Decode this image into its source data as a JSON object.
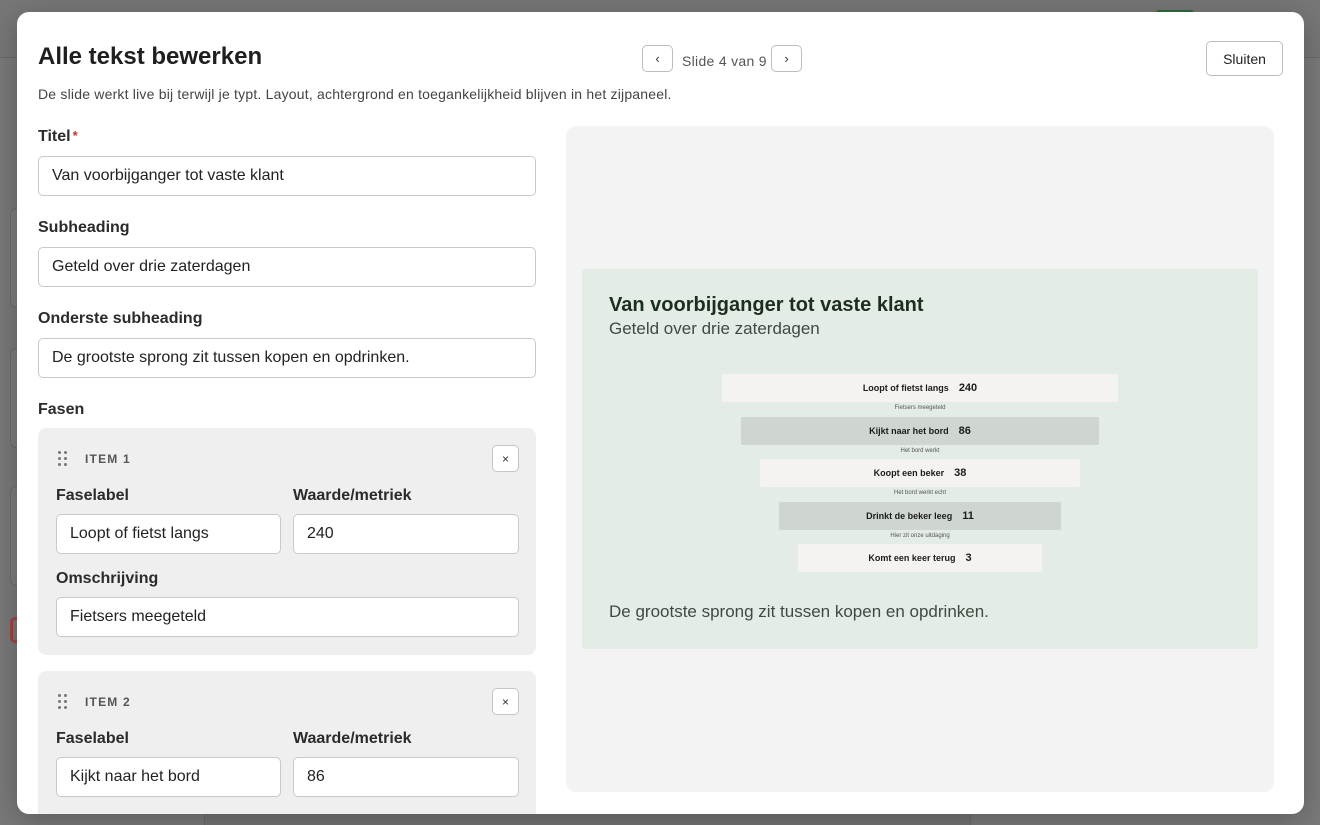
{
  "modal": {
    "title": "Alle tekst bewerken",
    "description": "De slide werkt live bij terwijl je typt. Layout, achtergrond en toegankelijkheid blijven in het zijpaneel.",
    "prev_label": "‹",
    "next_label": "›",
    "slide_counter": "Slide 4 van 9",
    "close_label": "Sluiten"
  },
  "form": {
    "title_label": "Titel",
    "required_mark": "*",
    "title_value": "Van voorbijganger tot vaste klant",
    "subheading_label": "Subheading",
    "subheading_value": "Geteld over drie zaterdagen",
    "bottom_subheading_label": "Onderste subheading",
    "bottom_subheading_value": "De grootste sprong zit tussen kopen en opdrinken.",
    "phases_label": "Fasen",
    "phase_label_text": "Faselabel",
    "value_label_text": "Waarde/metriek",
    "description_label_text": "Omschrijving",
    "remove_label": "×",
    "items": [
      {
        "tag": "ITEM 1",
        "label": "Loopt of fietst langs",
        "value": "240",
        "description": "Fietsers meegeteld"
      },
      {
        "tag": "ITEM 2",
        "label": "Kijkt naar het bord",
        "value": "86",
        "description": "Het bord werkt"
      }
    ]
  },
  "preview": {
    "title": "Van voorbijganger tot vaste klant",
    "subtitle": "Geteld over drie zaterdagen",
    "footer": "De grootste sprong zit tussen kopen en opdrinken.",
    "bar_colors": [
      "#f5f3ef",
      "#cfd6d0"
    ]
  },
  "chart_data": {
    "type": "bar",
    "categories": [
      "Loopt of fietst langs",
      "Kijkt naar het bord",
      "Koopt een beker",
      "Drinkt de beker leeg",
      "Komt een keer terug"
    ],
    "values": [
      240,
      86,
      38,
      11,
      3
    ],
    "value_labels": [
      "240",
      "86",
      "38",
      "11",
      "3"
    ],
    "annotations": [
      "Fietsers meegeteld",
      "Het bord werkt",
      "Het bord werkt echt",
      "Hier zit onze uitdaging"
    ],
    "title": "Van voorbijganger tot vaste klant",
    "subtitle": "Geteld over drie zaterdagen"
  }
}
